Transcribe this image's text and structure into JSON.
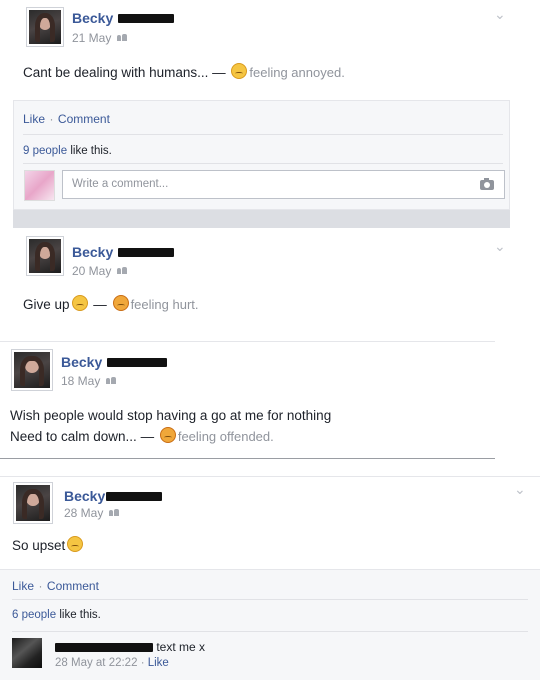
{
  "post1": {
    "name": "Becky",
    "date": "21 May",
    "message": "Cant be dealing with humans... —",
    "feeling": "feeling annoyed.",
    "actions": {
      "like": "Like",
      "separator": "·",
      "comment": "Comment"
    },
    "likes": {
      "count": "9 people",
      "text": "like this."
    },
    "comment_placeholder": "Write a comment..."
  },
  "post2": {
    "name": "Becky",
    "date": "20 May",
    "message": "Give up",
    "dash": "—",
    "feeling": "feeling hurt."
  },
  "post3": {
    "name": "Becky",
    "date": "18 May",
    "line1": "Wish people would stop having a go at me for nothing",
    "line2": "Need to calm down... —",
    "feeling": "feeling offended."
  },
  "post4": {
    "name": "Becky",
    "date": "28 May",
    "message": "So upset",
    "actions": {
      "like": "Like",
      "separator": "·",
      "comment": "Comment"
    },
    "likes": {
      "count": "6 people",
      "text": "like this."
    },
    "comment": {
      "text": "text me x",
      "date": "28 May at 22:22",
      "separator": "·",
      "like": "Like"
    }
  },
  "icons": {
    "chevron": "chevron-down-icon",
    "camera": "camera-icon",
    "audience": "friends-icon"
  }
}
